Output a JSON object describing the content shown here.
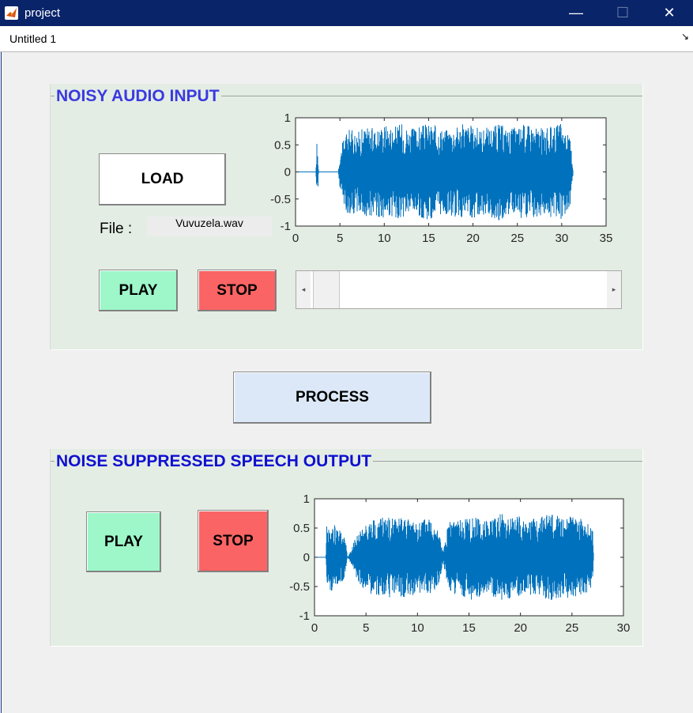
{
  "window": {
    "title": "project",
    "minimize": "—",
    "maximize": "☐",
    "close": "✕"
  },
  "menu": {
    "item": "Untitled 1",
    "dock_glyph": "↘"
  },
  "input_panel": {
    "title": "NOISY AUDIO INPUT",
    "load_label": "LOAD",
    "file_label": "File :",
    "file_value": "Vuvuzela.wav",
    "play_label": "PLAY",
    "stop_label": "STOP",
    "slider": {
      "value_fraction": 0.0
    }
  },
  "process_label": "PROCESS",
  "output_panel": {
    "title": "NOISE SUPPRESSED SPEECH OUTPUT",
    "play_label": "PLAY",
    "stop_label": "STOP"
  },
  "colors": {
    "title_blue_input": "#3a3ae0",
    "title_blue_output": "#1010d0",
    "wave": "#0072bd"
  },
  "chart_data": [
    {
      "type": "line",
      "title": "",
      "xlabel": "",
      "ylabel": "",
      "xlim": [
        0,
        35
      ],
      "ylim": [
        -1,
        1
      ],
      "xticks": [
        0,
        5,
        10,
        15,
        20,
        25,
        30,
        35
      ],
      "yticks": [
        1,
        0.5,
        0,
        -0.5,
        -1
      ],
      "ytick_labels": [
        "1",
        "0.5",
        "0",
        "-0.5",
        "-1"
      ],
      "series": [
        {
          "x": [
            0.0,
            2.3,
            2.4,
            2.5,
            2.6,
            4.8,
            5.0,
            5.5,
            6.0,
            7.0,
            8.0,
            9.0,
            10.0,
            11.0,
            12.0,
            13.0,
            14.0,
            15.0,
            16.0,
            17.0,
            18.0,
            19.0,
            20.0,
            21.0,
            22.0,
            23.0,
            24.0,
            25.0,
            26.0,
            27.0,
            28.0,
            29.0,
            30.0,
            31.0,
            31.3
          ],
          "y": [
            0.0,
            0.0,
            0.6,
            -0.45,
            0.0,
            0.0,
            0.3,
            0.7,
            0.8,
            0.75,
            0.85,
            0.8,
            0.9,
            0.85,
            0.9,
            0.8,
            0.85,
            0.9,
            0.85,
            0.8,
            0.85,
            0.9,
            0.85,
            0.8,
            0.85,
            0.9,
            0.8,
            0.85,
            0.9,
            0.85,
            0.8,
            0.85,
            0.9,
            0.6,
            0.0
          ]
        }
      ]
    },
    {
      "type": "line",
      "title": "",
      "xlabel": "",
      "ylabel": "",
      "xlim": [
        0,
        30
      ],
      "ylim": [
        -1,
        1
      ],
      "xticks": [
        0,
        5,
        10,
        15,
        20,
        25,
        30
      ],
      "yticks": [
        1,
        0.5,
        0,
        -0.5,
        -1
      ],
      "ytick_labels": [
        "1",
        "0.5",
        "0",
        "-0.5",
        "-1"
      ],
      "series": [
        {
          "x": [
            0.0,
            1.1,
            1.2,
            2.0,
            3.0,
            3.2,
            3.5,
            4.0,
            5.0,
            6.0,
            7.0,
            8.0,
            9.0,
            10.0,
            11.0,
            12.0,
            12.5,
            13.0,
            14.0,
            15.0,
            16.0,
            17.0,
            18.0,
            19.0,
            20.0,
            21.0,
            22.0,
            23.0,
            24.0,
            25.0,
            26.0,
            27.0,
            27.1
          ],
          "y": [
            0.0,
            0.0,
            0.6,
            0.55,
            0.35,
            0.0,
            0.1,
            0.35,
            0.6,
            0.65,
            0.7,
            0.65,
            0.7,
            0.6,
            0.7,
            0.5,
            0.1,
            0.6,
            0.65,
            0.75,
            0.7,
            0.65,
            0.75,
            0.7,
            0.7,
            0.65,
            0.7,
            0.75,
            0.7,
            0.7,
            0.65,
            0.55,
            0.0
          ]
        }
      ]
    }
  ]
}
